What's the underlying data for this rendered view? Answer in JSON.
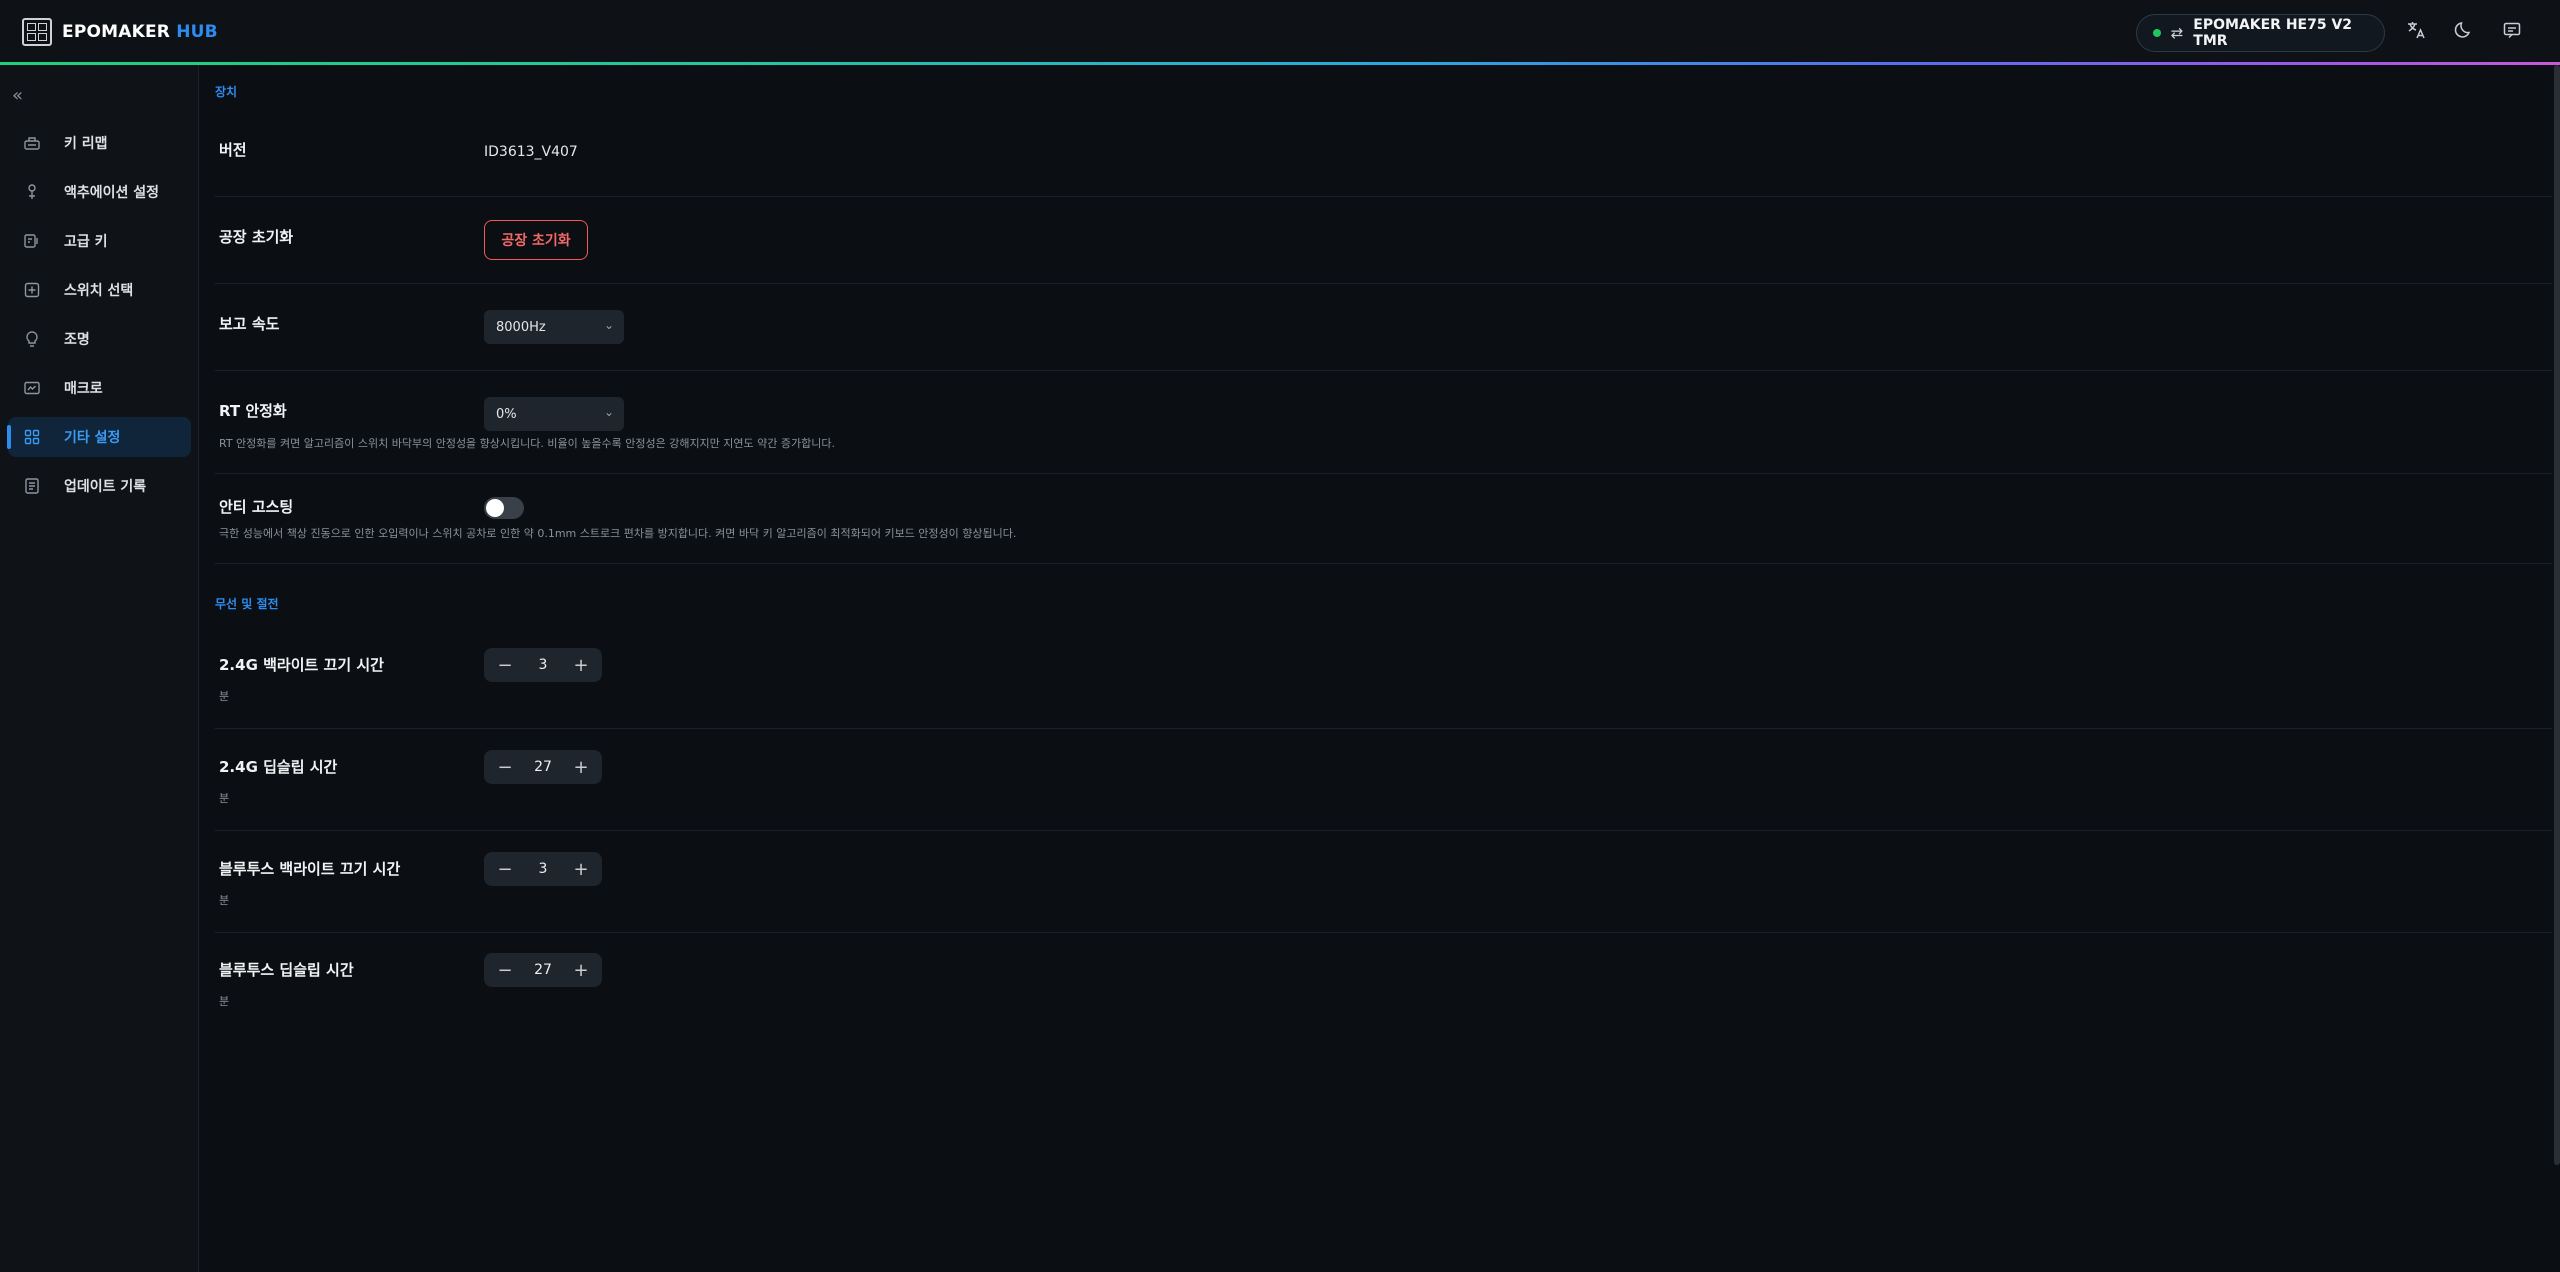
{
  "header": {
    "brand_main": "EPOMAKER",
    "brand_accent": "HUB",
    "device_name": "EPOMAKER HE75 V2 TMR",
    "icons": [
      "translate-icon",
      "moon-icon",
      "chat-icon"
    ]
  },
  "sidebar": {
    "items": [
      {
        "label": "키 리맵",
        "icon": "keyboard-icon"
      },
      {
        "label": "액추에이션 설정",
        "icon": "actuation-icon"
      },
      {
        "label": "고급 키",
        "icon": "advanced-key-icon"
      },
      {
        "label": "스위치 선택",
        "icon": "switch-icon"
      },
      {
        "label": "조명",
        "icon": "bulb-icon"
      },
      {
        "label": "매크로",
        "icon": "macro-icon"
      },
      {
        "label": "기타 설정",
        "icon": "grid-icon",
        "active": true
      },
      {
        "label": "업데이트 기록",
        "icon": "document-icon"
      }
    ]
  },
  "device_section": {
    "title": "장치",
    "version_label": "버전",
    "version_value": "ID3613_V407",
    "factory_reset_label": "공장 초기화",
    "factory_reset_button": "공장 초기화",
    "report_rate_label": "보고 속도",
    "report_rate_value": "8000Hz",
    "rt_label": "RT 안정화",
    "rt_value": "0%",
    "rt_desc": "RT 안정화를 켜면 알고리즘이 스위치 바닥부의 안정성을 향상시킵니다. 비율이 높을수록 안정성은 강해지지만 지연도 약간 증가합니다.",
    "anti_ghost_label": "안티 고스팅",
    "anti_ghost_on": false,
    "anti_ghost_desc": "극한 성능에서 책상 진동으로 인한 오입력이나 스위치 공차로 인한 약 0.1mm 스트로크 편차를 방지합니다. 켜면 바닥 키 알고리즘이 최적화되어 키보드 안정성이 향상됩니다."
  },
  "wireless_section": {
    "title": "무선 및 절전",
    "items": [
      {
        "label": "2.4G 백라이트 끄기 시간",
        "value": "3",
        "unit": "분"
      },
      {
        "label": "2.4G 딥슬립 시간",
        "value": "27",
        "unit": "분"
      },
      {
        "label": "블루투스 백라이트 끄기 시간",
        "value": "3",
        "unit": "분"
      },
      {
        "label": "블루투스 딥슬립 시간",
        "value": "27",
        "unit": "분"
      }
    ]
  },
  "colors": {
    "accent": "#2d8cf0",
    "danger": "#f05a5a",
    "status_connected": "#22c55e"
  }
}
